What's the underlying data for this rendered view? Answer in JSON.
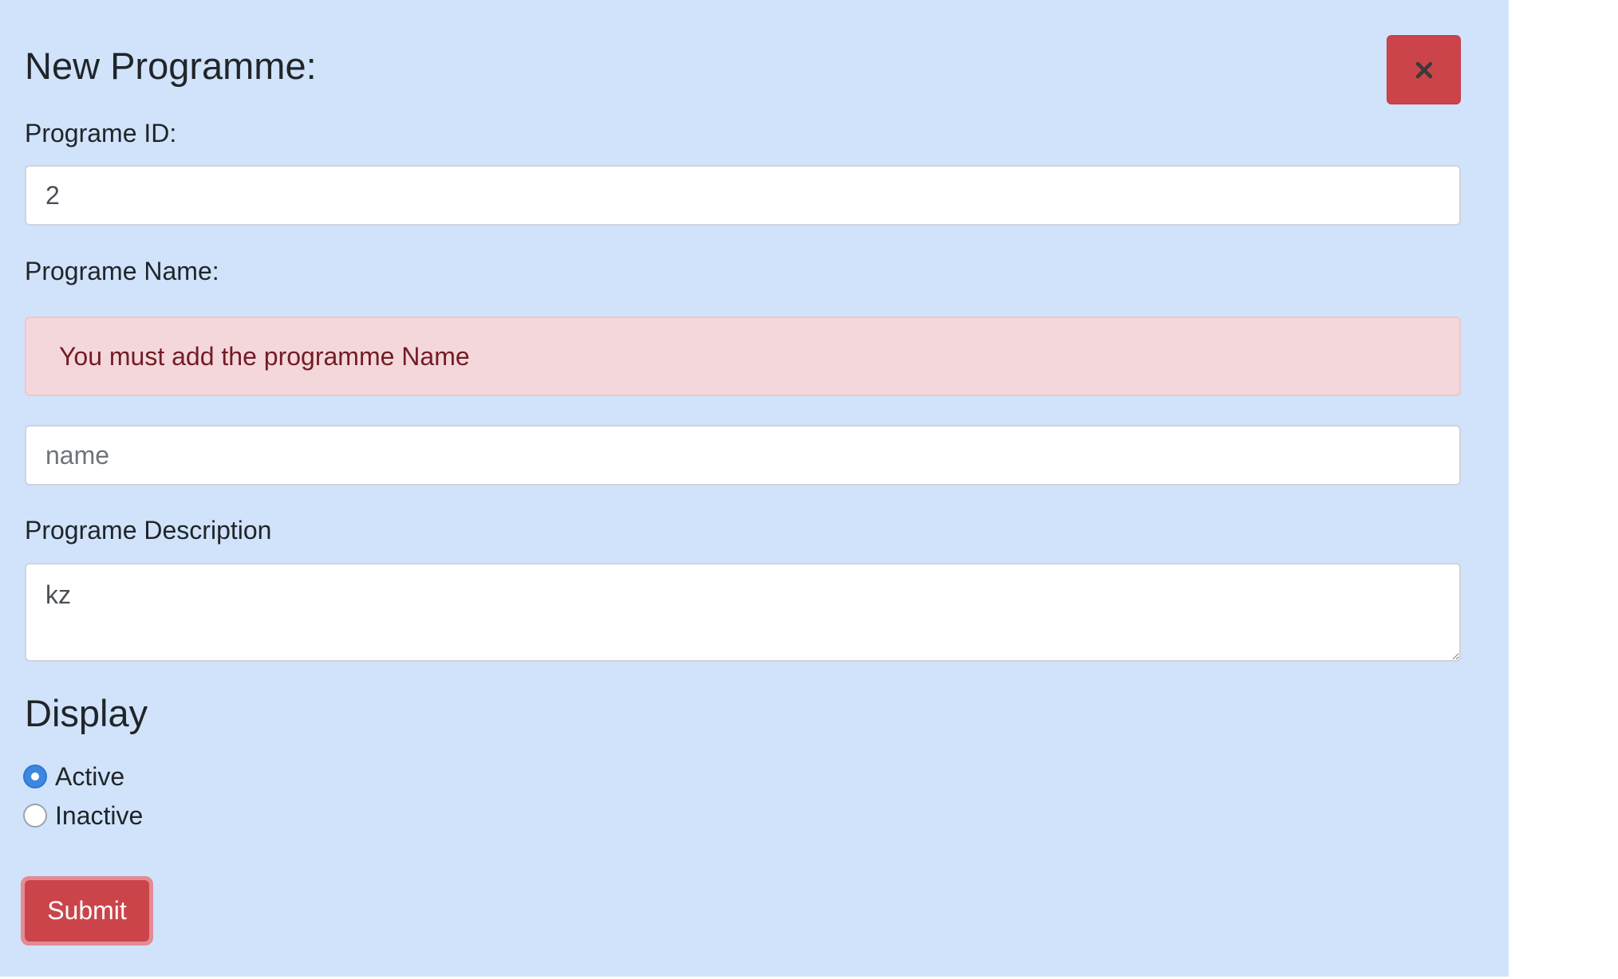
{
  "form": {
    "title": "New Programme:",
    "close_icon": "close-icon",
    "id_label": "Programe ID:",
    "id_value": "2",
    "name_label": "Programe Name:",
    "name_error": "You must add the programme Name",
    "name_value": "",
    "name_placeholder": "name",
    "description_label": "Programe Description",
    "description_value": "kz",
    "display_title": "Display",
    "display_options": [
      {
        "label": "Active",
        "checked": true
      },
      {
        "label": "Inactive",
        "checked": false
      }
    ],
    "submit_label": "Submit"
  },
  "colors": {
    "panel_background": "#d0e3fb",
    "danger": "#cb444a",
    "alert_background": "#f4d7db",
    "alert_text": "#721c24",
    "radio_checked": "#3d87e0"
  }
}
